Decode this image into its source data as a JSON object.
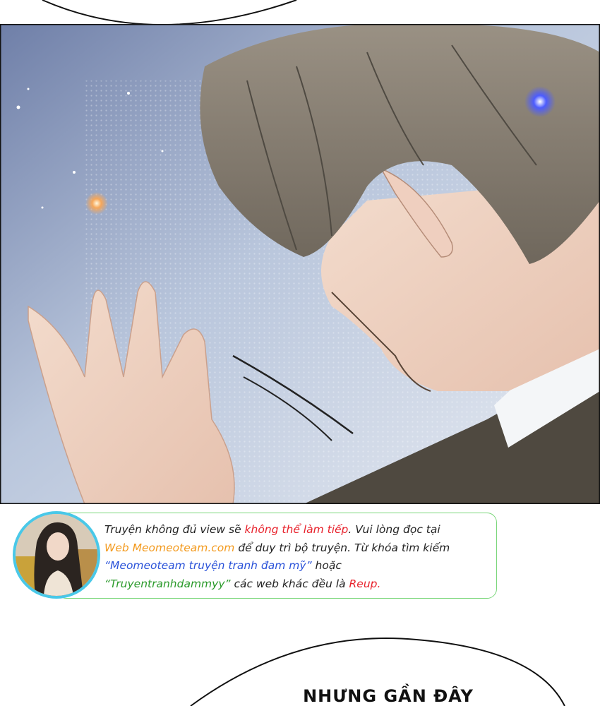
{
  "notice": {
    "line1_a": "Truyện không đủ view sẽ ",
    "line1_b": "không thể làm tiếp",
    "line1_c": ". Vui lòng đọc tại",
    "line2_a": "Web Meomeoteam.com",
    "line2_b": " để duy trì bộ truyện. Từ khóa tìm kiếm",
    "line3_a": "“Meomeoteam truyện tranh đam mỹ”",
    "line3_b": " hoặc",
    "line4_a": "“Truyentranhdammyy”",
    "line4_b": " các web khác đều là ",
    "line4_c": "Reup."
  },
  "speech_bubble": {
    "text": "NHƯNG GẦN ĐÂY"
  },
  "colors": {
    "warning_red": "#e8212b",
    "site_orange": "#f39a1e",
    "keyword_blue": "#2b53d9",
    "keyword_green": "#2a9a2a",
    "notice_border": "#7bd77b",
    "avatar_ring": "#49c8e8"
  },
  "icons": {
    "avatar": "profile-picture-avatar"
  }
}
